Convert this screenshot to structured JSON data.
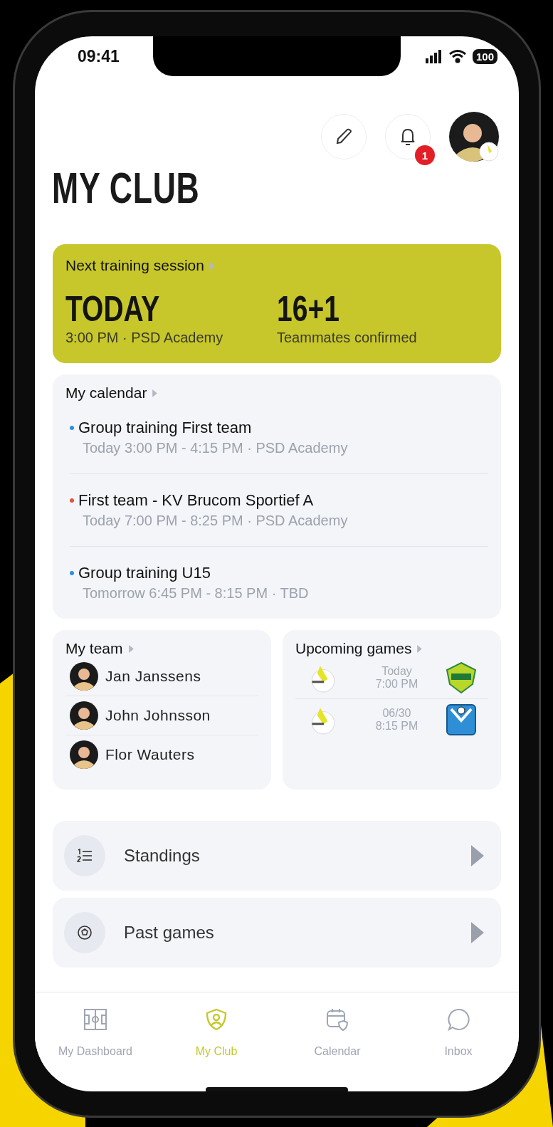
{
  "status_bar": {
    "time": "09:41",
    "battery": "100"
  },
  "header": {
    "title": "MY CLUB",
    "notification_count": "1"
  },
  "next_training": {
    "heading": "Next training session",
    "day": "TODAY",
    "day_detail": "3:00 PM · PSD Academy",
    "count": "16+1",
    "count_label": "Teammates confirmed"
  },
  "calendar": {
    "heading": "My calendar",
    "events": [
      {
        "title": "Group training First team",
        "detail": "Today 3:00 PM - 4:15 PM · PSD Academy",
        "color": "#2f8fe0"
      },
      {
        "title": "First team - KV Brucom Sportief A",
        "detail": "Today 7:00 PM - 8:25 PM · PSD Academy",
        "color": "#e0553b"
      },
      {
        "title": "Group training U15",
        "detail": "Tomorrow 6:45 PM - 8:15 PM · TBD",
        "color": "#2f8fe0"
      }
    ]
  },
  "team": {
    "heading": "My team",
    "members": [
      "Jan Janssens",
      "John Johnsson",
      "Flor Wauters"
    ]
  },
  "upcoming_games": {
    "heading": "Upcoming games",
    "games": [
      {
        "date": "Today",
        "time": "7:00 PM",
        "kind": "shield"
      },
      {
        "date": "06/30",
        "time": "8:15 PM",
        "kind": "square"
      }
    ]
  },
  "links": [
    {
      "label": "Standings",
      "kind": "standings"
    },
    {
      "label": "Past games",
      "kind": "past"
    }
  ],
  "tabs": [
    {
      "label": "My Dashboard",
      "kind": "dashboard",
      "selected": false
    },
    {
      "label": "My Club",
      "kind": "club",
      "selected": true
    },
    {
      "label": "Calendar",
      "kind": "calendar",
      "selected": false
    },
    {
      "label": "Inbox",
      "kind": "inbox",
      "selected": false
    }
  ]
}
